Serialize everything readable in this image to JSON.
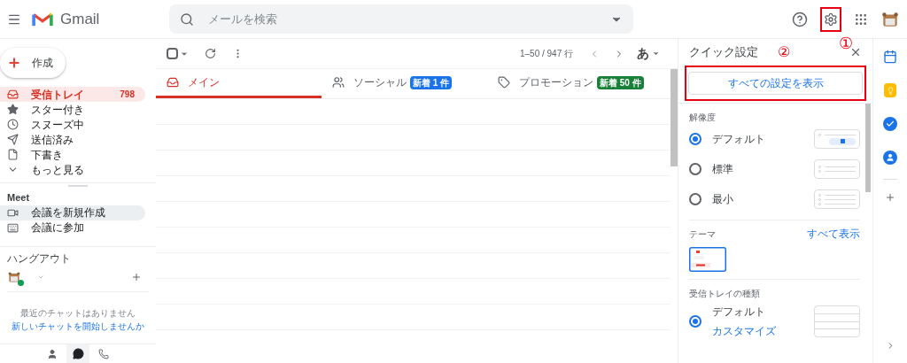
{
  "header": {
    "app_name": "Gmail",
    "search_placeholder": "メールを検索"
  },
  "annotations": {
    "settings_mark": "①",
    "all_settings_mark": "②"
  },
  "sidebar": {
    "compose": "作成",
    "items": [
      {
        "label": "受信トレイ",
        "count": "798",
        "selected": true
      },
      {
        "label": "スター付き",
        "selected": false
      },
      {
        "label": "スヌーズ中",
        "selected": false
      },
      {
        "label": "送信済み",
        "selected": false
      },
      {
        "label": "下書き",
        "selected": false
      },
      {
        "label": "もっと見る",
        "selected": false
      }
    ],
    "meet": {
      "title": "Meet",
      "items": [
        {
          "label": "会議を新規作成",
          "selected": true
        },
        {
          "label": "会議に参加",
          "selected": false
        }
      ]
    },
    "hangouts": {
      "title": "ハングアウト",
      "empty": "最近のチャットはありません",
      "link": "新しいチャットを開始しませんか"
    }
  },
  "toolbar": {
    "select_all": {
      "checked": false
    },
    "page_info": "1–50 / 947 行",
    "input_tool": "あ"
  },
  "tabs": [
    {
      "label": "メイン",
      "selected": true
    },
    {
      "label": "ソーシャル",
      "badge": "新着 1 件",
      "color": "#1a73e8",
      "selected": false
    },
    {
      "label": "プロモーション",
      "badge": "新着 50 件",
      "color": "#188038",
      "selected": false
    }
  ],
  "quick_settings": {
    "title": "クイック設定",
    "all_settings": "すべての設定を表示",
    "density": {
      "title": "解像度",
      "options": [
        {
          "label": "デフォルト",
          "selected": true
        },
        {
          "label": "標準",
          "selected": false
        },
        {
          "label": "最小",
          "selected": false
        }
      ]
    },
    "theme": {
      "title": "テーマ",
      "link": "すべて表示"
    },
    "inbox_type": {
      "title": "受信トレイの種類",
      "options": [
        {
          "label": "デフォルト",
          "link": "カスタマイズ",
          "selected": true
        }
      ]
    }
  }
}
